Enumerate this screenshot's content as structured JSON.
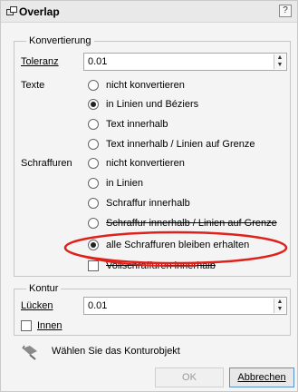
{
  "window": {
    "title": "Overlap",
    "help_label": "?"
  },
  "conversion": {
    "legend": "Konvertierung",
    "tolerance_label": "Toleranz",
    "tolerance_value": "0.01",
    "texts_label": "Texte",
    "text_options": [
      {
        "label": "nicht konvertieren",
        "selected": false
      },
      {
        "label": "in Linien und Béziers",
        "selected": true
      },
      {
        "label": "Text innerhalb",
        "selected": false
      },
      {
        "label": "Text innerhalb / Linien auf Grenze",
        "selected": false
      }
    ],
    "hatch_label": "Schraffuren",
    "hatch_options": [
      {
        "label": "nicht konvertieren",
        "selected": false
      },
      {
        "label": "in Linien",
        "selected": false
      },
      {
        "label": "Schraffur innerhalb",
        "selected": false
      },
      {
        "label": "Schraffur innerhalb / Linien auf Grenze",
        "selected": false
      },
      {
        "label": "alle Schraffuren bleiben erhalten",
        "selected": true
      }
    ],
    "solid_fill_label": "Vollschraffuren innerhalb",
    "solid_fill_checked": false
  },
  "contour": {
    "legend": "Kontur",
    "gaps_label": "Lücken",
    "gaps_value": "0.01",
    "inner_label": "Innen",
    "inner_checked": false
  },
  "footer": {
    "hint": "Wählen Sie das Konturobjekt",
    "ok_label": "OK",
    "cancel_label": "Abbrechen"
  },
  "colors": {
    "annotation_ellipse": "#e0201a"
  }
}
